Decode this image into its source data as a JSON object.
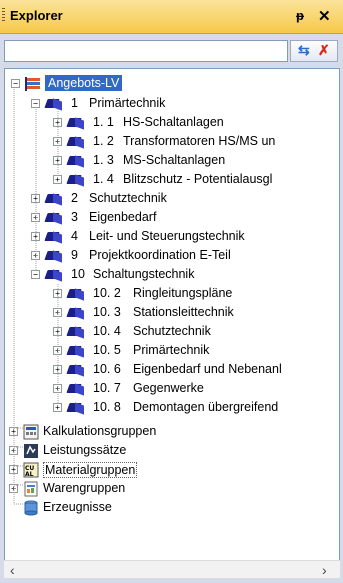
{
  "window": {
    "title": "Explorer",
    "pin_glyph": "ᵽ",
    "close_glyph": "✕"
  },
  "search": {
    "placeholder": "",
    "sync_icon": "⇆",
    "clear_filter_icon": "✗"
  },
  "tree": {
    "root": {
      "label": "Angebots-LV",
      "icon": "catalog-icon"
    },
    "nodes": [
      {
        "key": "n1",
        "num": "1",
        "label": "Primärtechnik",
        "expanded": true
      },
      {
        "key": "n11",
        "num": "1. 1",
        "label": "HS-Schaltanlagen"
      },
      {
        "key": "n12",
        "num": "1. 2",
        "label": "Transformatoren HS/MS un"
      },
      {
        "key": "n13",
        "num": "1. 3",
        "label": "MS-Schaltanlagen"
      },
      {
        "key": "n14",
        "num": "1. 4",
        "label": "Blitzschutz - Potentialausgl"
      },
      {
        "key": "n2",
        "num": "2",
        "label": "Schutztechnik"
      },
      {
        "key": "n3",
        "num": "3",
        "label": "Eigenbedarf"
      },
      {
        "key": "n4",
        "num": "4",
        "label": "Leit- und Steuerungstechnik"
      },
      {
        "key": "n9",
        "num": "9",
        "label": "Projektkoordination E-Teil"
      },
      {
        "key": "n10",
        "num": "10",
        "label": "Schaltungstechnik",
        "expanded": true
      },
      {
        "key": "n102",
        "num": "10. 2",
        "label": "Ringleitungspläne"
      },
      {
        "key": "n103",
        "num": "10. 3",
        "label": "Stationsleittechnik"
      },
      {
        "key": "n104",
        "num": "10. 4",
        "label": "Schutztechnik"
      },
      {
        "key": "n105",
        "num": "10. 5",
        "label": "Primärtechnik"
      },
      {
        "key": "n106",
        "num": "10. 6",
        "label": "Eigenbedarf und Nebenanl"
      },
      {
        "key": "n107",
        "num": "10. 7",
        "label": "Gegenwerke"
      },
      {
        "key": "n108",
        "num": "10. 8",
        "label": "Demontagen übergreifend"
      }
    ],
    "groups": [
      {
        "label": "Kalkulationsgruppen",
        "icon": "calculation-groups-icon"
      },
      {
        "label": "Leistungssätze",
        "icon": "service-sets-icon"
      },
      {
        "label": "Materialgruppen",
        "icon": "material-groups-icon"
      },
      {
        "label": "Warengruppen",
        "icon": "product-groups-icon"
      },
      {
        "label": "Erzeugnisse",
        "icon": "products-icon"
      }
    ]
  },
  "colors": {
    "titlebar": "#f6c94a",
    "root_selected": "#316ac5",
    "book": "#1a1f86"
  }
}
